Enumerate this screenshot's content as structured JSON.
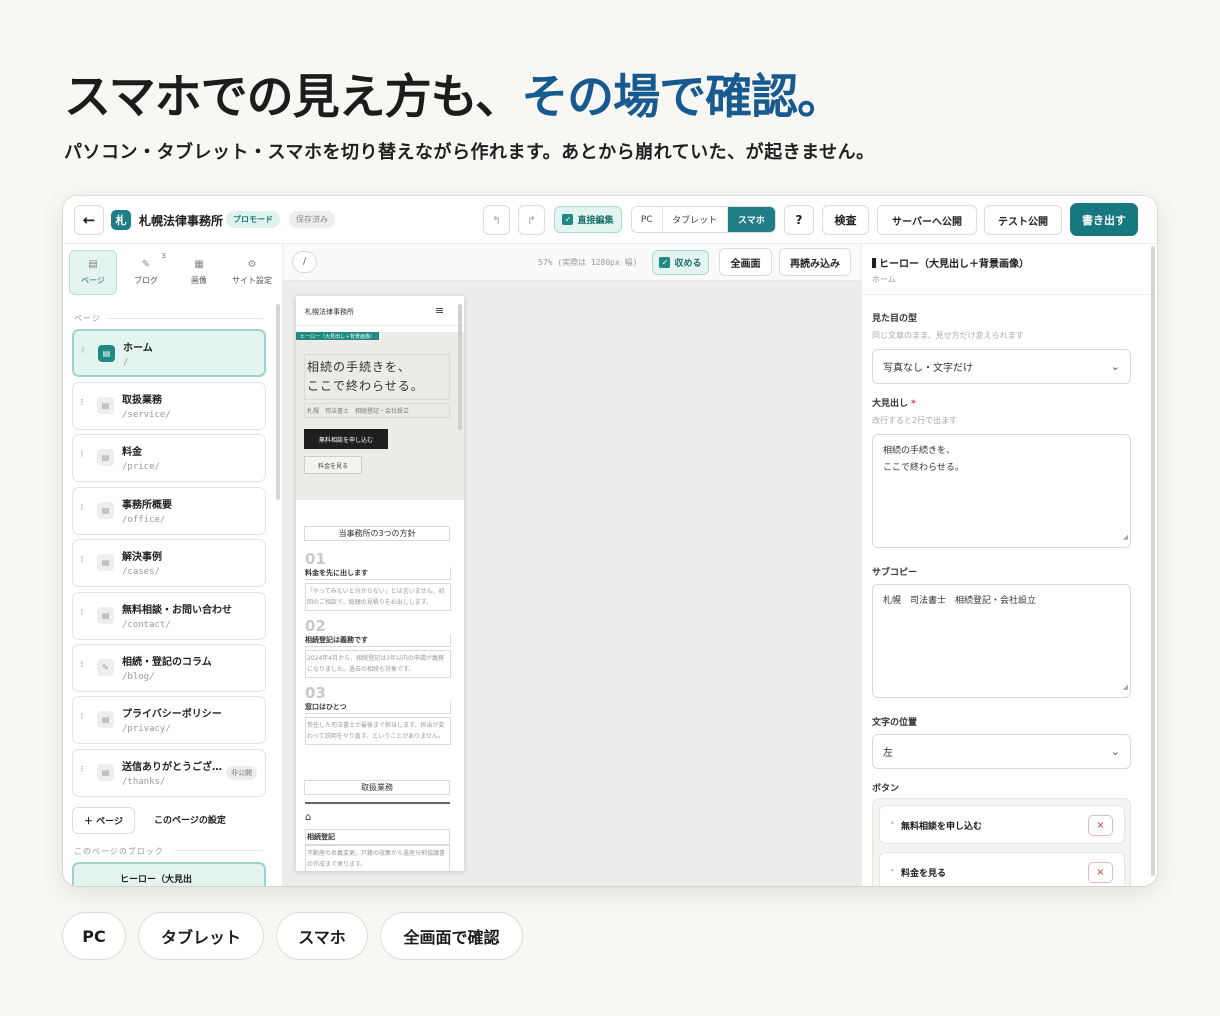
{
  "headline": {
    "main": "スマホでの見え方も、",
    "accent": "その場で確認。"
  },
  "subhead": "パソコン・タブレット・スマホを切り替えながら作れます。あとから崩れていた、が起きません。",
  "colors": {
    "accent_blue": "#175a8f",
    "brand_teal": "#1f7e85",
    "background": "#f8f7f3"
  },
  "topbar": {
    "back_icon": "←",
    "logo_char": "札",
    "site_name": "札幌法律事務所",
    "mode_badge": "プロモード",
    "saved_badge": "保存済み",
    "undo_icon": "↰",
    "redo_icon": "↱",
    "direct_edit": "直接編集",
    "device_tabs": [
      "PC",
      "タブレット",
      "スマホ"
    ],
    "active_device": "スマホ",
    "help": "?",
    "inspect": "検査",
    "publish": "サーバーへ公開",
    "test_publish": "テスト公開",
    "export": "書き出す"
  },
  "sidebar": {
    "tabs": [
      {
        "label": "ページ",
        "icon": "▤"
      },
      {
        "label": "ブログ",
        "icon": "✎",
        "badge": "3"
      },
      {
        "label": "画像",
        "icon": "▦"
      },
      {
        "label": "サイト設定",
        "icon": "⚙"
      }
    ],
    "pages_label": "ページ",
    "pages": [
      {
        "name": "ホーム",
        "path": "/"
      },
      {
        "name": "取扱業務",
        "path": "/service/"
      },
      {
        "name": "料金",
        "path": "/price/"
      },
      {
        "name": "事務所概要",
        "path": "/office/"
      },
      {
        "name": "解決事例",
        "path": "/cases/"
      },
      {
        "name": "無料相談・お問い合わせ",
        "path": "/contact/"
      },
      {
        "name": "相続・登記のコラム",
        "path": "/blog/"
      },
      {
        "name": "プライバシーポリシー",
        "path": "/privacy/"
      },
      {
        "name": "送信ありがとうござ…",
        "path": "/thanks/",
        "badge": "非公開"
      }
    ],
    "add_page": "＋ ページ",
    "page_settings": "このページの設定",
    "blocks_label": "このページのブロック",
    "block_partial": "ヒーロー（大見出"
  },
  "canvas": {
    "path": "/",
    "zoom": "57% (実際は 1280px 幅)",
    "fold": "収める",
    "fullscreen": "全画面",
    "reload": "再読み込み"
  },
  "preview": {
    "site_name": "札幌法律事務所",
    "menu_icon": "≡",
    "hero_tag": "ヒーロー（大見出し＋背景画像）",
    "heading": "相続の手続きを、\nここで終わらせる。",
    "subcopy": "札幌　司法書士　相続登記・会社設立",
    "cta_primary": "無料相談を申し込む",
    "cta_secondary": "料金を見る",
    "policy_title": "当事務所の3つの方針",
    "policies": [
      {
        "num": "01",
        "title": "料金を先に出します",
        "desc": "「やってみないと分からない」とは言いません。初回のご相談で、総額の見積りをお出しします。"
      },
      {
        "num": "02",
        "title": "相続登記は義務です",
        "desc": "2024年4月から、相続登記は3年以内の申請が義務になりました。過去の相続も対象です。"
      },
      {
        "num": "03",
        "title": "窓口はひとつ",
        "desc": "受任した司法書士が最後まで担当します。担当が変わって説明をやり直す、ということがありません。"
      }
    ],
    "services_title": "取扱業務",
    "home_icon": "⌂",
    "service_name": "相続登記",
    "service_desc": "不動産の名義変更。戸籍の収集から遺産分割協議書の作成まで承ります。"
  },
  "panel": {
    "title": "ヒーロー（大見出し＋背景画像）",
    "crumb": "ホーム",
    "look_label": "見た目の型",
    "look_hint": "同じ文章のまま、見せ方だけ変えられます",
    "look_value": "写真なし・文字だけ",
    "heading_label": "大見出し",
    "required": "*",
    "heading_hint": "改行すると2行で出ます",
    "heading_value": "相続の手続きを、\nここで終わらせる。",
    "subcopy_label": "サブコピー",
    "subcopy_value": "札幌　司法書士　相続登記・会社設立",
    "align_label": "文字の位置",
    "align_value": "左",
    "buttons_label": "ボタン",
    "buttons": [
      "無料相談を申し込む",
      "料金を見る"
    ],
    "remove_icon": "×",
    "chevron_icon": "⌄"
  },
  "bottom_pills": [
    "PC",
    "タブレット",
    "スマホ",
    "全画面で確認"
  ]
}
